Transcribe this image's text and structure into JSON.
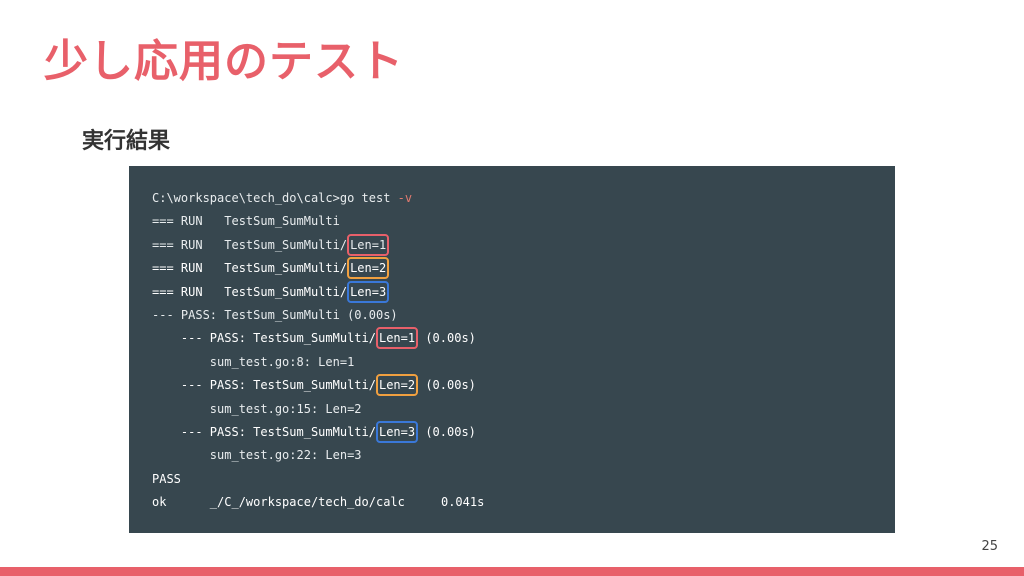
{
  "slide": {
    "title": "少し応用のテスト",
    "section_label": "実行結果",
    "page_number": "25"
  },
  "terminal": {
    "lines": [
      {
        "pre": "C:\\workspace\\tech_do\\calc>go test ",
        "flag": "-v",
        "box": "",
        "post": "",
        "box_color": ""
      },
      {
        "pre": "=== RUN   TestSum_SumMulti",
        "flag": "",
        "box": "",
        "post": "",
        "box_color": ""
      },
      {
        "pre": "=== RUN   TestSum_SumMulti/",
        "flag": "",
        "box": "Len=1",
        "post": "",
        "box_color": "#e8606a"
      },
      {
        "pre": "=== RUN   TestSum_SumMulti/",
        "flag": "",
        "box": "Len=2",
        "post": "",
        "box_color": "#f0a040"
      },
      {
        "pre": "=== RUN   TestSum_SumMulti/",
        "flag": "",
        "box": "Len=3",
        "post": "",
        "box_color": "#3a78d8"
      },
      {
        "pre": "--- PASS: TestSum_SumMulti (0.00s)",
        "flag": "",
        "box": "",
        "post": "",
        "box_color": ""
      },
      {
        "pre": "    --- PASS: TestSum_SumMulti/",
        "flag": "",
        "box": "Len=1",
        "post": " (0.00s)",
        "box_color": "#e8606a"
      },
      {
        "pre": "        sum_test.go:8: Len=1",
        "flag": "",
        "box": "",
        "post": "",
        "box_color": ""
      },
      {
        "pre": "    --- PASS: TestSum_SumMulti/",
        "flag": "",
        "box": "Len=2",
        "post": " (0.00s)",
        "box_color": "#f0a040"
      },
      {
        "pre": "        sum_test.go:15: Len=2",
        "flag": "",
        "box": "",
        "post": "",
        "box_color": ""
      },
      {
        "pre": "    --- PASS: TestSum_SumMulti/",
        "flag": "",
        "box": "Len=3",
        "post": " (0.00s)",
        "box_color": "#3a78d8"
      },
      {
        "pre": "        sum_test.go:22: Len=3",
        "flag": "",
        "box": "",
        "post": "",
        "box_color": ""
      },
      {
        "pre": "PASS",
        "flag": "",
        "box": "",
        "post": "",
        "box_color": ""
      },
      {
        "pre": "ok      _/C_/workspace/tech_do/calc     0.041s",
        "flag": "",
        "box": "",
        "post": "",
        "box_color": ""
      }
    ]
  },
  "colors": {
    "accent": "#e8606a",
    "terminal_bg": "#37474f",
    "box_red": "#e8606a",
    "box_orange": "#f0a040",
    "box_blue": "#3a78d8"
  }
}
